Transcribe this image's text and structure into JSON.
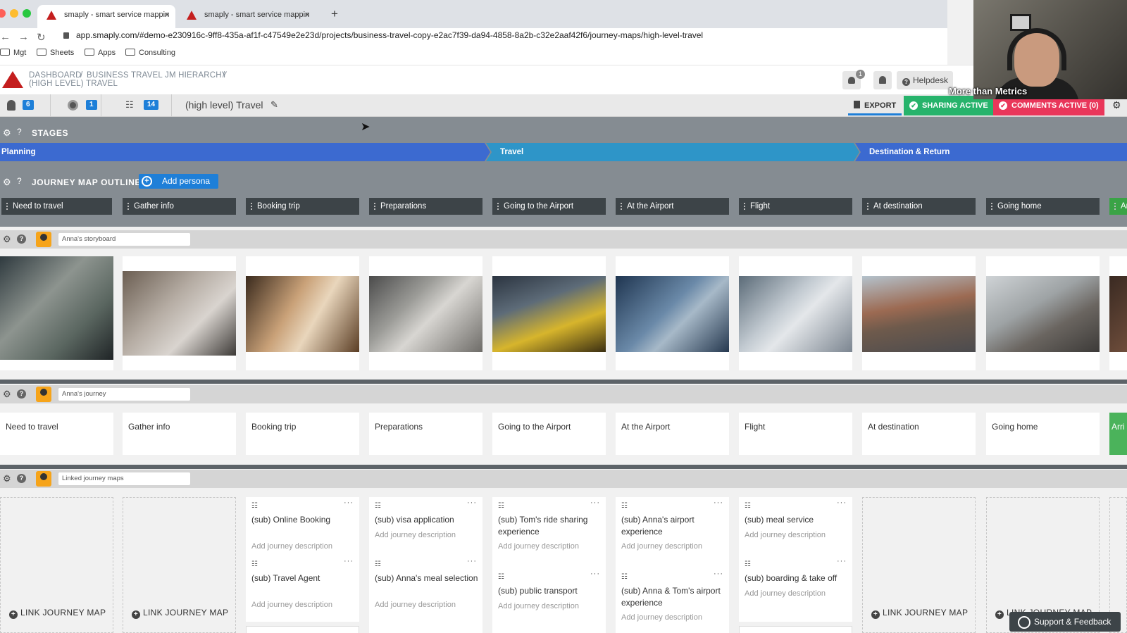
{
  "browser": {
    "tabs": [
      {
        "label": "smaply - smart service mappin"
      },
      {
        "label": "smaply - smart service mappin"
      }
    ],
    "new_tab": "+",
    "url": "app.smaply.com/#demo-e230916c-9ff8-435a-af1f-c47549e2e23d/projects/business-travel-copy-e2ac7f39-da94-4858-8a2b-c32e2aaf42f6/journey-maps/high-level-travel",
    "bookmarks": [
      "Mgt",
      "Sheets",
      "Apps",
      "Consulting"
    ]
  },
  "header": {
    "breadcrumb": [
      "DASHBOARD",
      "/",
      "BUSINESS TRAVEL JM HIERARCHY",
      "/",
      "(HIGH LEVEL) TRAVEL"
    ],
    "notification_count": "1",
    "helpdesk": "Helpdesk"
  },
  "toolbar": {
    "personas_count": "6",
    "channels_count": "1",
    "lanes_count": "14",
    "map_title": "(high level) Travel",
    "export": "EXPORT",
    "sharing": "SHARING ACTIVE",
    "comments": "COMMENTS ACTIVE (0)"
  },
  "stages": {
    "title": "STAGES",
    "items": [
      {
        "label": "Planning",
        "color": "#3c6ad0"
      },
      {
        "label": "Travel",
        "color": "#2e95c8"
      },
      {
        "label": "Destination & Return",
        "color": "#3c6ad0"
      }
    ]
  },
  "outline": {
    "title": "JOURNEY MAP OUTLINE",
    "add_persona": "Add persona",
    "steps": [
      "Need to travel",
      "Gather info",
      "Booking trip",
      "Preparations",
      "Going to the Airport",
      "At the Airport",
      "Flight",
      "At destination",
      "Going home",
      "Ar"
    ]
  },
  "lanes": {
    "storyboard": "Anna's storyboard",
    "journey": "Anna's journey",
    "linked": "Linked journey maps"
  },
  "journey_cards": [
    "Need to travel",
    "Gather info",
    "Booking trip",
    "Preparations",
    "Going to the Airport",
    "At the Airport",
    "Flight",
    "At destination",
    "Going home",
    "Arri"
  ],
  "linked": {
    "link_label": "LINK JOURNEY MAP",
    "desc_placeholder": "Add journey description",
    "subs": [
      {
        "title": "(sub) Online Booking"
      },
      {
        "title": "(sub) Travel Agent"
      },
      {
        "title": "(sub) visa application"
      },
      {
        "title": "(sub) Anna's meal selection"
      },
      {
        "title": "(sub) Tom's ride sharing experience"
      },
      {
        "title": "(sub) public transport"
      },
      {
        "title": "(sub) Anna's airport experience"
      },
      {
        "title": "(sub) Anna & Tom's airport experience"
      },
      {
        "title": "(sub) meal service"
      },
      {
        "title": "(sub) boarding & take off"
      }
    ]
  },
  "webcam": {
    "caption": "More than Metrics"
  },
  "support": "Support & Feedback"
}
